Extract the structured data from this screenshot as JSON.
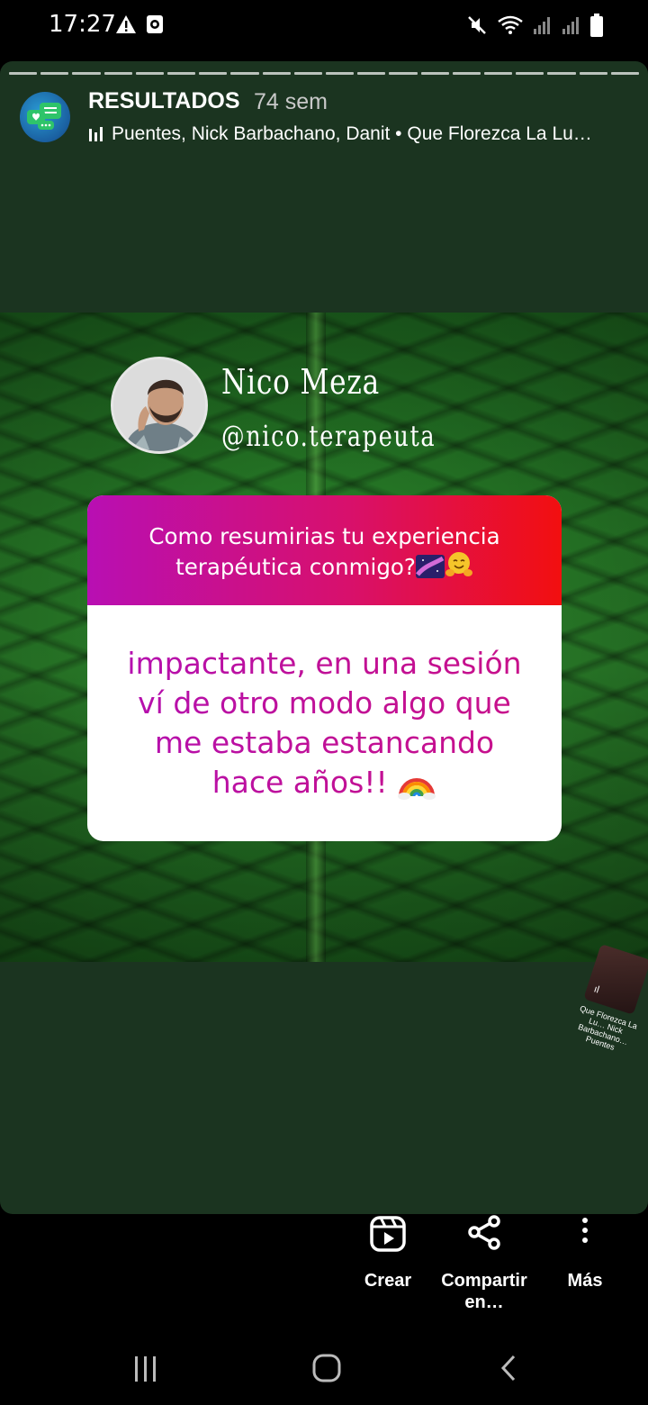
{
  "status_bar": {
    "time": "17:27"
  },
  "story": {
    "title": "RESULTADOS",
    "age": "74 sem",
    "music_text": "Puentes, Nick Barbachano, Danit • Que Florezca La Lu…",
    "progress_segments": 20
  },
  "content": {
    "profile_name": "Nico Meza",
    "profile_handle": "@nico.terapeuta",
    "question": "Como resumirias tu experiencia terapéutica conmigo?",
    "answer": "impactante, en una sesión ví de otro modo algo que me estaba estancando hace años!!",
    "sticker_caption": "Que Florezca La Lu… Nick Barbachano… Puentes"
  },
  "actions": {
    "crear": "Crear",
    "compartir": "Compartir en…",
    "mas": "Más"
  },
  "colors": {
    "story_bg": "#1b3420",
    "question_gradient_start": "#b80fb3",
    "question_gradient_end": "#f20f0f",
    "answer_color": "#c0109a"
  },
  "icons": {
    "warning": "warning-icon",
    "note": "note-icon",
    "mute": "mute-icon",
    "wifi": "wifi-icon",
    "signal": "signal-icon",
    "battery": "battery-icon",
    "reels": "reels-icon",
    "share": "share-icon",
    "more": "more-vertical-icon",
    "recents": "recents-icon",
    "home": "home-icon",
    "back": "back-icon"
  }
}
